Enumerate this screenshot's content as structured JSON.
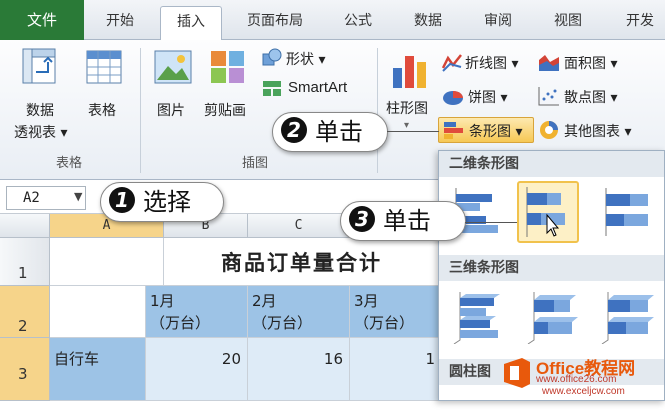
{
  "ribbon_tabs": [
    "文件",
    "开始",
    "插入",
    "页面布局",
    "公式",
    "数据",
    "审阅",
    "视图",
    "开发"
  ],
  "ribbon": {
    "pivot_label_1": "数据",
    "pivot_label_2": "透视表",
    "table_label": "表格",
    "picture_label": "图片",
    "clipart_label": "剪贴画",
    "shapes_label": "形状",
    "smartart_label": "SmartArt",
    "column_chart_label": "柱形图",
    "line_chart_label": "折线图",
    "area_chart_label": "面积图",
    "pie_chart_label": "饼图",
    "scatter_chart_label": "散点图",
    "bar_chart_label": "条形图",
    "other_charts_label": "其他图表",
    "group_tables": "表格",
    "group_illustrations": "插图"
  },
  "name_box": "A2",
  "columns": [
    "A",
    "B",
    "C"
  ],
  "rows": [
    "1",
    "2",
    "3"
  ],
  "sheet": {
    "title": "商品订单量合计",
    "header_b_1": "1月",
    "header_b_2": "（万台）",
    "header_c_1": "2月",
    "header_c_2": "（万台）",
    "header_d_1": "3月",
    "header_d_2": "（万台）",
    "row3_label": "自行车",
    "row3_values": [
      "20",
      "16",
      "1"
    ]
  },
  "dropdown": {
    "section_2d": "二维条形图",
    "section_3d": "三维条形图",
    "section_cyl": "圆柱图"
  },
  "callouts": {
    "step1": "选择",
    "step2": "单击",
    "step3": "单击",
    "n1": "1",
    "n2": "2",
    "n3": "3"
  },
  "watermark": {
    "line1": "Office教程网",
    "line2": "www.office26.com",
    "line3": "www.exceljcw.com"
  },
  "colors": {
    "file_tab": "#2a7a37",
    "selection": "#f6d48a",
    "highlight_thumb": "#f1c24c",
    "header_cell": "#9dc3e6"
  }
}
